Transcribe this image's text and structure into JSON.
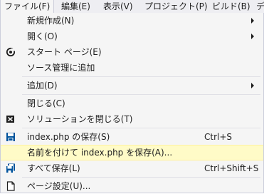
{
  "menubar": {
    "items": [
      {
        "label": "ファイル(F)"
      },
      {
        "label": "編集(E)"
      },
      {
        "label": "表示(V)"
      },
      {
        "label": "プロジェクト(P)"
      },
      {
        "label": "ビルド(B)"
      },
      {
        "label": "デ"
      }
    ]
  },
  "menu": {
    "items": [
      {
        "label": "新規作成(N)"
      },
      {
        "label": "開く(O)"
      },
      {
        "label": "スタート ページ(E)",
        "icon": "start-page-icon"
      },
      {
        "label": "ソース管理に追加"
      },
      {
        "label": "追加(D)"
      },
      {
        "label": "閉じる(C)"
      },
      {
        "label": "ソリューションを閉じる(T)",
        "icon": "close-solution-icon"
      },
      {
        "label": "index.php の保存(S)",
        "shortcut": "Ctrl+S",
        "icon": "save-icon"
      },
      {
        "label": "名前を付けて index.php を保存(A)..."
      },
      {
        "label": "すべて保存(L)",
        "shortcut": "Ctrl+Shift+S",
        "icon": "save-all-icon"
      },
      {
        "label": "ページ設定(U)...",
        "icon": "page-setup-icon"
      }
    ]
  },
  "colors": {
    "menubar_bg": "#eeeef2",
    "menu_bg": "#f5f5f5",
    "highlight_bg": "#fffbc7",
    "highlight_border": "#fff29d",
    "text": "#1e1e1e"
  }
}
